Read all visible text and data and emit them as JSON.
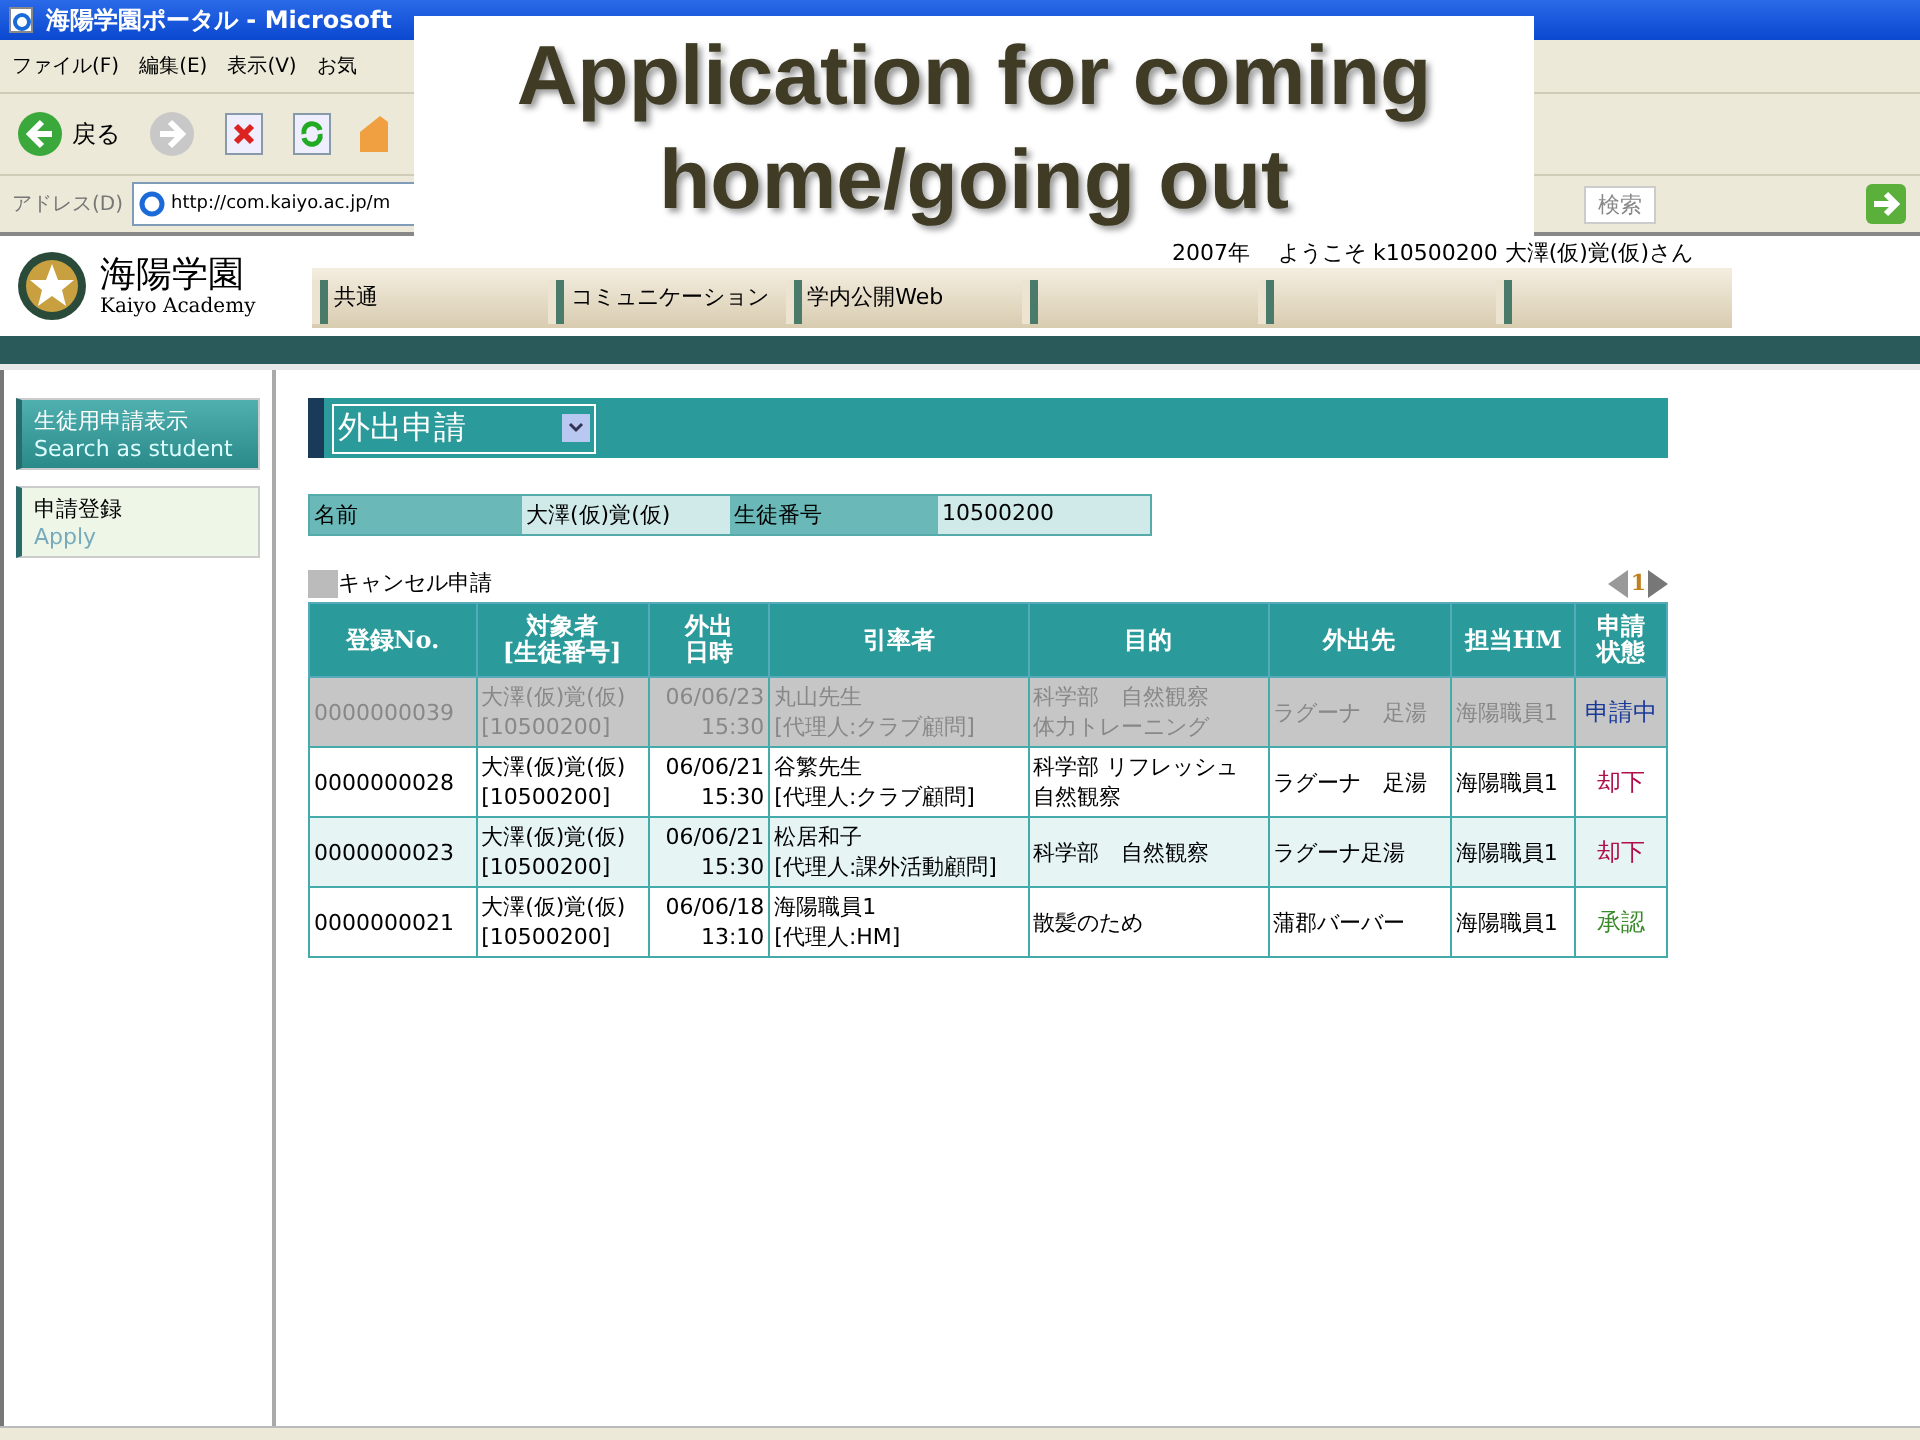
{
  "window": {
    "title": "海陽学園ポータル - Microsoft"
  },
  "menu": [
    "ファイル(F)",
    "編集(E)",
    "表示(V)",
    "お気"
  ],
  "toolbar": {
    "back": "戻る"
  },
  "address": {
    "label": "アドレス(D)",
    "value": "http://com.kaiyo.ac.jp/m",
    "search": "検索"
  },
  "overlay": {
    "title": "Application for coming home/going out"
  },
  "header": {
    "logo_title": "海陽学園",
    "logo_subtitle": "Kaiyo Academy",
    "year": "2007年",
    "welcome": "ようこそ k10500200 大澤(仮)覚(仮)さん"
  },
  "nav_tabs": [
    "共通",
    "コミュニケーション",
    "学内公開Web"
  ],
  "sidebar": {
    "items": [
      {
        "label": "生徒用申請表示",
        "sublabel": "Search as student",
        "selected": true
      },
      {
        "label": "申請登録",
        "sublabel": "Apply",
        "selected": false
      }
    ]
  },
  "form": {
    "type_select": "外出申請"
  },
  "student": {
    "name_label": "名前",
    "name": "大澤(仮)覚(仮)",
    "id_label": "生徒番号",
    "id": "10500200"
  },
  "legend": {
    "label": "キャンセル申請"
  },
  "pager": {
    "page": "1"
  },
  "table": {
    "columns": [
      "登録No.",
      "対象者\n[生徒番号]",
      [
        "外出",
        "日時"
      ],
      "引率者",
      "目的",
      "外出先",
      "担当HM",
      [
        "申請",
        "状態"
      ]
    ],
    "rows": [
      {
        "cancelled": true,
        "cells": [
          "0000000039",
          "大澤(仮)覚(仮)\n[10500200]",
          "06/06/23\n15:30",
          "丸山先生\n[代理人:クラブ顧問]",
          [
            "科学部　自然観察",
            "体力トレーニング"
          ],
          "ラグーナ　足湯",
          "海陽職員1",
          "申請中"
        ],
        "color": "#1a3a9a"
      },
      {
        "cancelled": false,
        "cells": [
          "0000000028",
          "大澤(仮)覚(仮)\n[10500200]",
          "06/06/21\n15:30",
          "谷繁先生\n[代理人:クラブ顧問]",
          [
            "科学部 リフレッシュ",
            "自然観察"
          ],
          "ラグーナ　足湯",
          "海陽職員1",
          "却下"
        ],
        "color": "#b0104a"
      },
      {
        "cancelled": false,
        "cells": [
          "0000000023",
          "大澤(仮)覚(仮)\n[10500200]",
          "06/06/21\n15:30",
          "松居和子\n[代理人:課外活動顧問]",
          "科学部　自然観察",
          "ラグーナ足湯",
          "海陽職員1",
          "却下"
        ],
        "color": "#b0104a"
      },
      {
        "cancelled": false,
        "cells": [
          "0000000021",
          "大澤(仮)覚(仮)\n[10500200]",
          "06/06/18\n13:10",
          "海陽職員1\n[代理人:HM]",
          "散髪のため",
          "蒲郡バーバー",
          "海陽職員1",
          "承認"
        ],
        "color": "#3a8a2a"
      }
    ]
  }
}
